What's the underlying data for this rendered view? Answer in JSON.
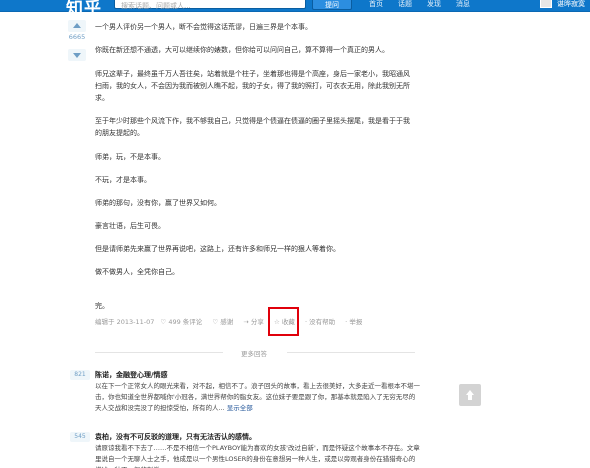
{
  "header": {
    "logo": "知乎",
    "search_placeholder": "搜索话题、问题或人...",
    "ask_label": "提问",
    "nav": [
      "首页",
      "话题",
      "发现",
      "消息"
    ],
    "user_name": "谌晔寂寞"
  },
  "answer": {
    "vote_count": "6665",
    "paragraphs": [
      "一个男人评价另一个男人，断不会觉得这话荒谬，日遍三界是个本事。",
      "你既在新还想不通透，大可以继续你的婊数，但你给可以问问自己，算不算得一个真正的男人。",
      "师兄这辈子，最终虽千万人吾往矣，站着就是个柱子，坐着那也得是个高座，身后一家老小，我昭通风扫雨，我的女人，不会因为我而被别人瞧不起，我的子女，得了我的照打，可衣衣无用，除此我别无所求。",
      "至于年少时那些个风流下作，我不够我自己，只觉得是个债逼在债逼的圈子里摇头摆尾，我是看于于我的朋友提起的。",
      "师弟，玩，不是本事。",
      "不玩，才是本事。",
      "师弟的那句，没有你，赢了世界又如何。",
      "豪言壮语，后生可畏。",
      "但是请师弟先来赢了世界再说吧，这路上，还有许多和师兄一样的狠人等着你。",
      "做不做男人，全凭你自己。",
      "完。"
    ],
    "meta": {
      "edited": "编辑于 2013-11-07",
      "comments": "499 条评论",
      "thanks": "感谢",
      "share": "分享",
      "collect": "收藏",
      "unhelpful": "没有帮助",
      "report": "举报"
    }
  },
  "more_answers_label": "更多回答",
  "other_answers": [
    {
      "count": "821",
      "author": "陈诺，金融登心理/情感",
      "text": "以在下一个正常女人的眼光来看，对不起，相信不了。浪子回头的故事，看上去很美好，大多走近一看根本不堪一击，你也知道全世界都喊你'小冠各，满世界帮你的脂女友。这位妹子要是跟了你，那基本就是陷入了无穷无尽的天人交战和没完没了的担惊受怕，所有的人...",
      "show_all": "显示全部"
    },
    {
      "count": "545",
      "author": "袁柏，没有不可反驳的道理，只有无法否认的感情。",
      "text": "请原谅我看不下去了……不是不相信一个PLAYBOY能为喜欢的女孩'改过自新'，而是怀疑这个故事本不存在。文章里说自一个无聊人士之手，他成是以一个男性LOSER的身份在意想另一种人生，或是以旁观者身份在猎猎奇心的描述一种不一般的刺激。"
    }
  ]
}
